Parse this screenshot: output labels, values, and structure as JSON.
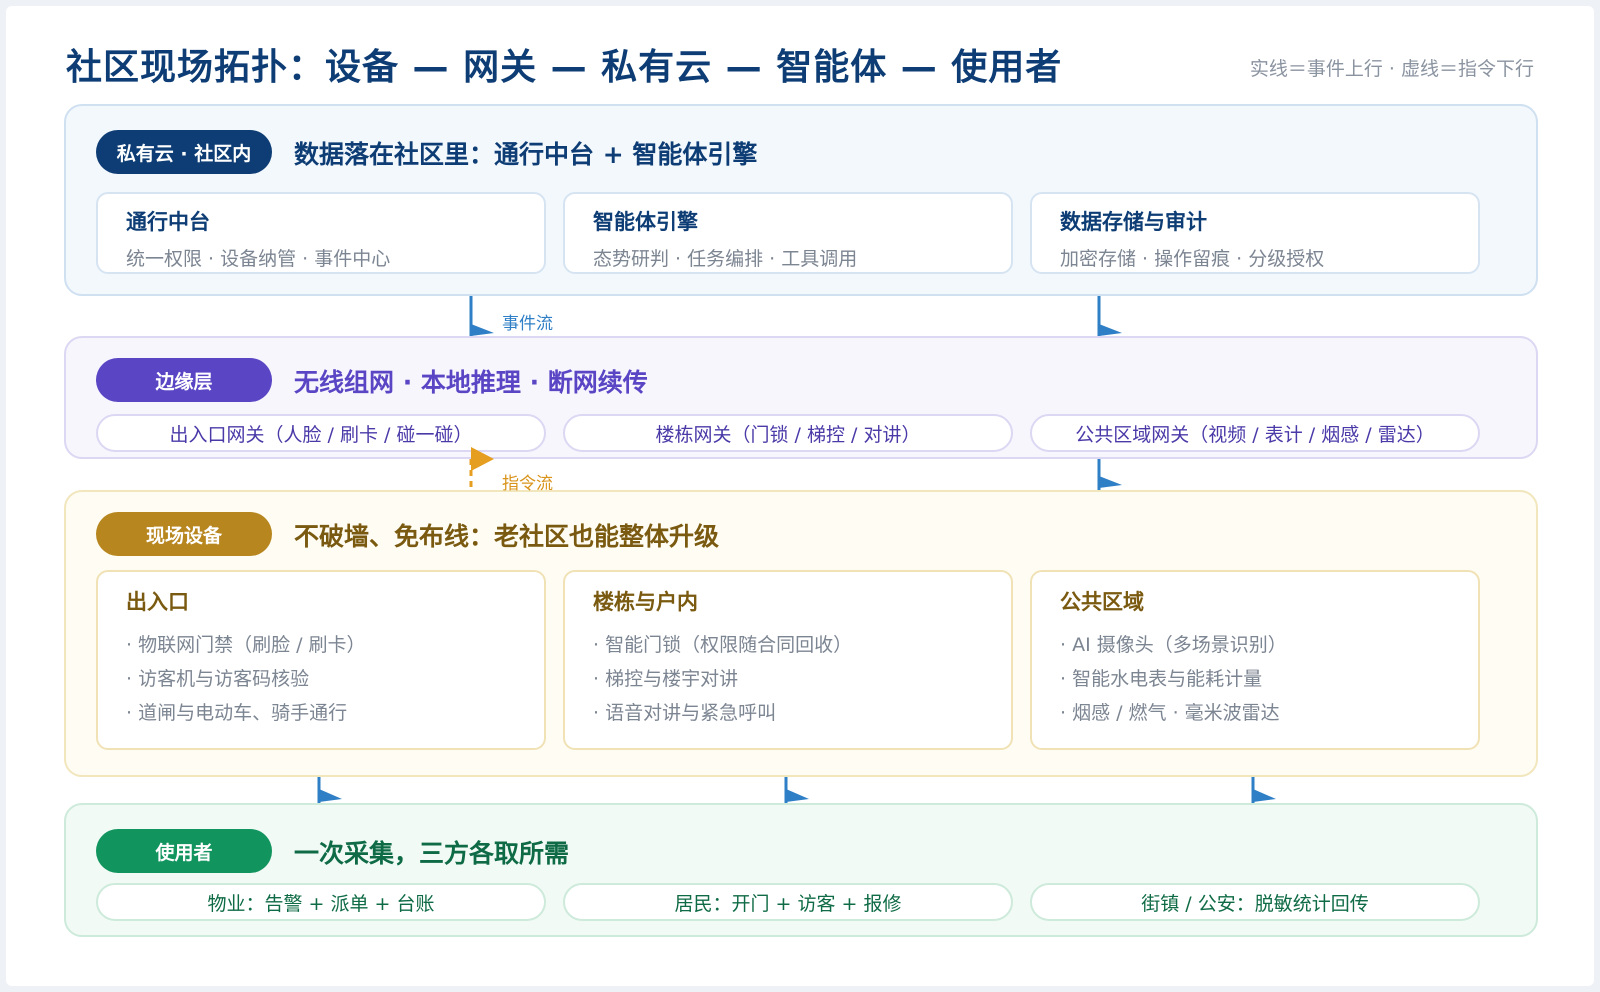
{
  "title": "社区现场拓扑：设备 — 网关 — 私有云 — 智能体 — 使用者",
  "legend": "实线＝事件上行 · 虚线＝指令下行",
  "flows": {
    "event_label": "事件流",
    "command_label": "指令流"
  },
  "colors": {
    "event_flow": "#2f7fc6",
    "command_flow": "#e59e1f"
  },
  "cloud": {
    "pill": "私有云 · 社区内",
    "headline": "数据落在社区里：通行中台 + 智能体引擎",
    "cards": [
      {
        "title": "通行中台",
        "sub": "统一权限 · 设备纳管 · 事件中心"
      },
      {
        "title": "智能体引擎",
        "sub": "态势研判 · 任务编排 · 工具调用"
      },
      {
        "title": "数据存储与审计",
        "sub": "加密存储 · 操作留痕 · 分级授权"
      }
    ]
  },
  "edge": {
    "pill": "边缘层",
    "headline": "无线组网 · 本地推理 · 断网续传",
    "chips": [
      "出入口网关（人脸 / 刷卡 / 碰一碰）",
      "楼栋网关（门锁 / 梯控 / 对讲）",
      "公共区域网关（视频 / 表计 / 烟感 / 雷达）"
    ]
  },
  "device": {
    "pill": "现场设备",
    "headline": "不破墙、免布线：老社区也能整体升级",
    "cards": [
      {
        "title": "出入口",
        "items": [
          "· 物联网门禁（刷脸 / 刷卡）",
          "· 访客机与访客码核验",
          "· 道闸与电动车、骑手通行"
        ]
      },
      {
        "title": "楼栋与户内",
        "items": [
          "· 智能门锁（权限随合同回收）",
          "· 梯控与楼宇对讲",
          "· 语音对讲与紧急呼叫"
        ]
      },
      {
        "title": "公共区域",
        "items": [
          "· AI 摄像头（多场景识别）",
          "· 智能水电表与能耗计量",
          "· 烟感 / 燃气 · 毫米波雷达"
        ]
      }
    ]
  },
  "user": {
    "pill": "使用者",
    "headline": "一次采集，三方各取所需",
    "chips": [
      "物业：告警 + 派单 + 台账",
      "居民：开门 + 访客 + 报修",
      "街镇 / 公安：脱敏统计回传"
    ]
  }
}
